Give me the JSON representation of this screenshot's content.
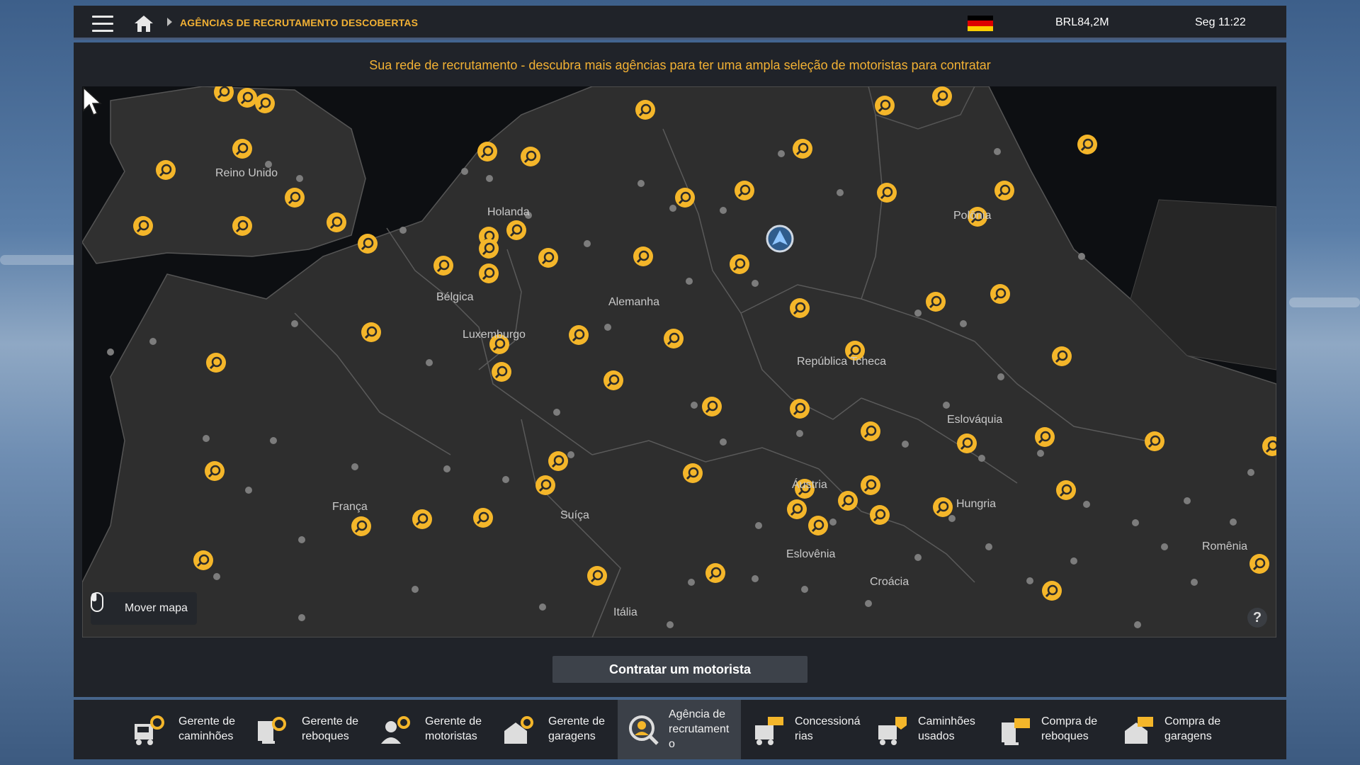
{
  "header": {
    "breadcrumb": "AGÊNCIAS DE RECRUTAMENTO DESCOBERTAS",
    "money": "BRL84,2M",
    "clock": "Seg 11:22",
    "flag_colors": [
      "#000000",
      "#dd0000",
      "#ffce00"
    ],
    "icons": [
      "menu-icon",
      "home-icon",
      "germany-flag-icon"
    ]
  },
  "main": {
    "subtitle": "Sua rede de recrutamento - descubra mais agências para ter uma ampla seleção de motoristas para contratar",
    "map": {
      "countries": [
        "Reino Unido",
        "Holanda",
        "Bélgica",
        "Luxemburgo",
        "Alemanha",
        "Polônia",
        "República Tcheca",
        "Eslováquia",
        "França",
        "Suíça",
        "Áustria",
        "Hungria",
        "Eslovênia",
        "Croácia",
        "Romênia",
        "Itália"
      ],
      "move_map_label": "Mover mapa",
      "help_label": "?",
      "accent": "#f4b62a"
    },
    "hire_button": "Contratar um motorista"
  },
  "bottom_nav": [
    {
      "line1": "Gerente de",
      "line2": "caminhões",
      "icon": "truck-gear-icon",
      "active": false
    },
    {
      "line1": "Gerente de",
      "line2": "reboques",
      "icon": "trailer-gear-icon",
      "active": false
    },
    {
      "line1": "Gerente de",
      "line2": "motoristas",
      "icon": "driver-gear-icon",
      "active": false
    },
    {
      "line1": "Gerente de",
      "line2": "garagens",
      "icon": "garage-gear-icon",
      "active": false
    },
    {
      "line1": "Agência de",
      "line2": "recrutament",
      "line3": "o",
      "icon": "recruitment-search-icon",
      "active": true
    },
    {
      "line1": "Concessioná",
      "line2": "rias",
      "icon": "dealer-icon",
      "active": false
    },
    {
      "line1": "Caminhões",
      "line2": "usados",
      "icon": "used-truck-icon",
      "active": false
    },
    {
      "line1": "Compra de",
      "line2": "reboques",
      "icon": "buy-trailer-icon",
      "active": false
    },
    {
      "line1": "Compra de",
      "line2": "garagens",
      "icon": "buy-garage-icon",
      "active": false
    }
  ]
}
